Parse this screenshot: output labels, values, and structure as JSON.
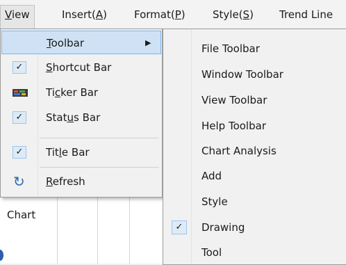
{
  "menubar": {
    "items": [
      {
        "pre": "",
        "ul": "V",
        "post": "iew"
      },
      {
        "pre": "Insert(",
        "ul": "A",
        "post": ")"
      },
      {
        "pre": "Format(",
        "ul": "P",
        "post": ")"
      },
      {
        "pre": "Style(",
        "ul": "S",
        "post": ")"
      },
      {
        "pre": "Trend Line",
        "ul": "",
        "post": ""
      }
    ]
  },
  "view_menu": {
    "items": [
      {
        "pre": "",
        "ul": "T",
        "post": "oolbar",
        "has_submenu": true,
        "highlighted": true
      },
      {
        "pre": "",
        "ul": "S",
        "post": "hortcut Bar",
        "checked": true
      },
      {
        "pre": "Ti",
        "ul": "c",
        "post": "ker Bar",
        "icon": "ticker-bar-icon"
      },
      {
        "pre": "Stat",
        "ul": "u",
        "post": "s Bar",
        "checked": true
      },
      {
        "pre": "Tit",
        "ul": "l",
        "post": "e Bar",
        "checked": true
      },
      {
        "pre": "",
        "ul": "R",
        "post": "efresh",
        "icon": "refresh-icon"
      }
    ]
  },
  "toolbar_submenu": {
    "items": [
      {
        "label": "File Toolbar"
      },
      {
        "label": "Window Toolbar"
      },
      {
        "label": "View Toolbar"
      },
      {
        "label": "Help Toolbar"
      },
      {
        "label": "Chart Analysis"
      },
      {
        "label": "Add"
      },
      {
        "label": "Style"
      },
      {
        "label": "Drawing",
        "checked": true
      },
      {
        "label": "Tool"
      }
    ]
  },
  "background": {
    "chart_label": "Chart"
  },
  "icons": {
    "submenu_arrow": "▶",
    "checkmark": "✓",
    "refresh": "↻"
  },
  "colors": {
    "highlight": "#cfe2f5",
    "highlight_border": "#7eb4ea",
    "check_box": "#deebf7"
  }
}
